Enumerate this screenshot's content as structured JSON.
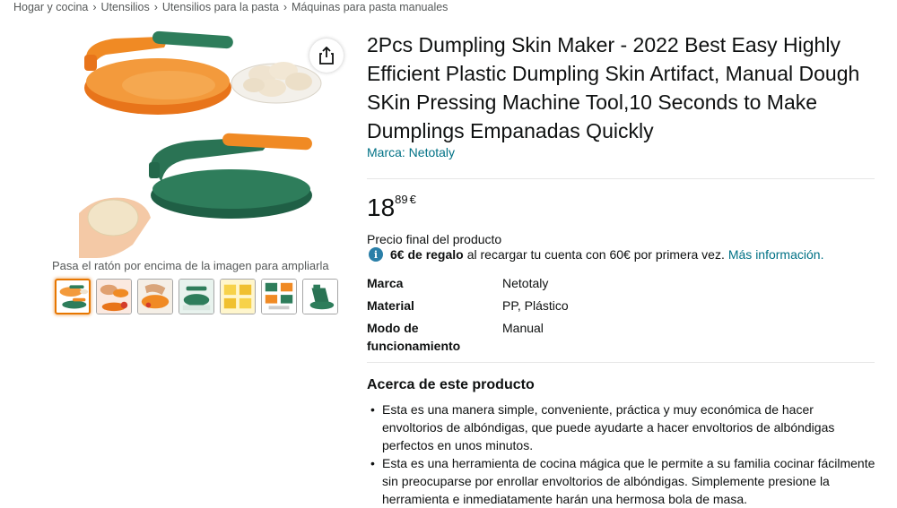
{
  "breadcrumb": [
    "Hogar y cocina",
    "Utensilios",
    "Utensilios para la pasta",
    "Máquinas para pasta manuales"
  ],
  "breadcrumb_separator": "›",
  "gallery": {
    "zoom_hint": "Pasa el ratón por encima de la imagen para ampliarla",
    "thumbnail_count": 7,
    "selected_index": 0
  },
  "product": {
    "title": "2Pcs Dumpling Skin Maker - 2022 Best Easy Highly Efficient Plastic Dumpling Skin Artifact, Manual Dough SKin Pressing Machine Tool,10 Seconds to Make Dumplings Empanadas Quickly",
    "brand_link": "Marca: Netotaly",
    "price_whole": "18",
    "price_fraction": "89",
    "price_currency": "€",
    "final_price_label": "Precio final del producto",
    "promo_bold": "6€ de regalo",
    "promo_text": "al recargar tu cuenta con 60€ por primera vez.",
    "promo_link": "Más información."
  },
  "specs": [
    {
      "label": "Marca",
      "value": "Netotaly"
    },
    {
      "label": "Material",
      "value": "PP, Plástico"
    },
    {
      "label": "Modo de funcionamiento",
      "value": "Manual"
    }
  ],
  "about": {
    "title": "Acerca de este producto",
    "bullets": [
      "Esta es una manera simple, conveniente, práctica y muy económica de hacer envoltorios de albóndigas, que puede ayudarte a hacer envoltorios de albóndigas perfectos en unos minutos.",
      "Esta es una herramienta de cocina mágica que le permite a su familia cocinar fácilmente sin preocuparse por enrollar envoltorios de albóndigas. Simplemente presione la herramienta e inmediatamente harán una hermosa bola de masa."
    ]
  },
  "colors": {
    "link": "#007185",
    "orange": "#f08a24",
    "green": "#2e7d5b",
    "selected_thumb_border": "#e77600"
  }
}
